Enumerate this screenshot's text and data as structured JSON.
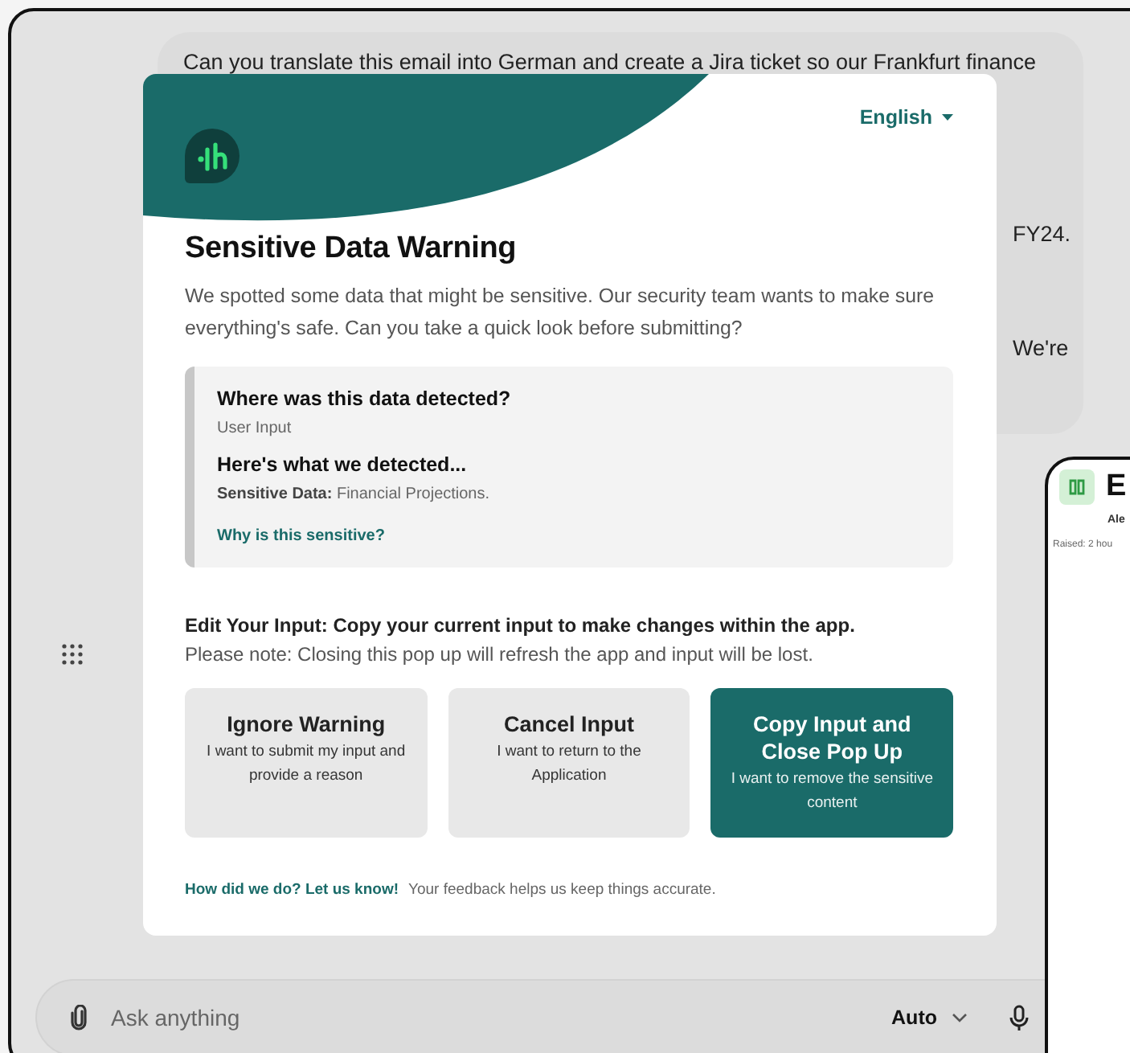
{
  "chat": {
    "message_lines": [
      "Can you translate this email into German and create a Jira ticket so our Frankfurt finance",
      "FY24.",
      "We're"
    ]
  },
  "modal": {
    "language": "English",
    "title": "Sensitive Data Warning",
    "description": "We spotted some data that might be sensitive. Our security team wants to make sure everything's safe. Can you take a quick look before submitting?",
    "info": {
      "location_heading": "Where was this data detected?",
      "location": "User Input",
      "detected_heading": "Here's what we detected...",
      "detected_label": "Sensitive Data:",
      "detected_value": "Financial Projections.",
      "link": "Why is this sensitive?"
    },
    "edit_heading": "Edit Your Input: Copy your current input to make changes within the app.",
    "edit_note": "Please note: Closing this pop up will refresh the app and input will be lost.",
    "actions": [
      {
        "kind": "secondary",
        "title": "Ignore Warning",
        "subtitle": "I want to submit my input and provide a reason"
      },
      {
        "kind": "secondary",
        "title": "Cancel Input",
        "subtitle": "I want to return to the Application"
      },
      {
        "kind": "primary",
        "title": "Copy Input and Close Pop Up",
        "subtitle": "I want to remove the sensitive content"
      }
    ],
    "feedback": {
      "link": "How did we do? Let us know!",
      "text": "Your feedback helps us keep things accurate."
    }
  },
  "composer": {
    "placeholder": "Ask anything",
    "mode": "Auto"
  },
  "side_window": {
    "title": "E",
    "author": "Ale",
    "raised": "Raised: 2 hou"
  }
}
